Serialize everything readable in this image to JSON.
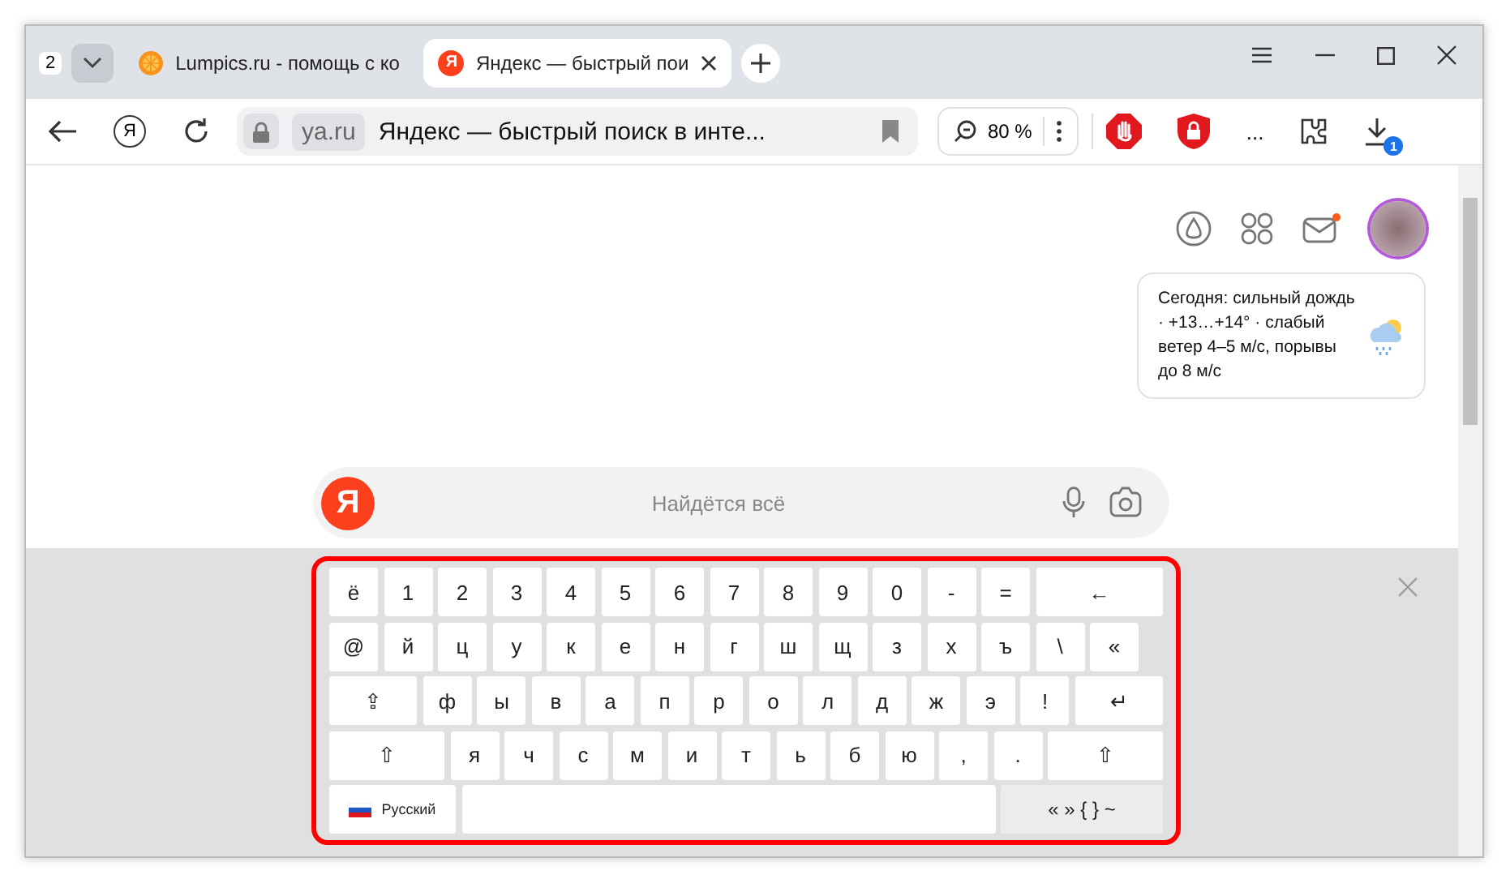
{
  "tab_bar": {
    "tab_count": "2",
    "tabs": [
      {
        "title": "Lumpics.ru - помощь с ко",
        "kind": "site",
        "selected": false
      },
      {
        "title": "Яндекс — быстрый пои",
        "kind": "yandex",
        "logo": "Я",
        "selected": true
      }
    ]
  },
  "toolbar": {
    "logo": "Я",
    "domain": "ya.ru",
    "page_title": "Яндекс — быстрый поиск в инте...",
    "zoom": "80 %",
    "more": "...",
    "downloads_badge": "1"
  },
  "page": {
    "weather": {
      "text": "Сегодня: сильный дождь · +13…+14° · слабый ветер 4–5 м/с, порывы до 8 м/с"
    },
    "search": {
      "logo": "Я",
      "placeholder": "Найдётся всё"
    }
  },
  "keyboard": {
    "rows": [
      {
        "keys": [
          {
            "label": "ё",
            "kind": "key"
          },
          {
            "label": "1",
            "kind": "key"
          },
          {
            "label": "2",
            "kind": "key"
          },
          {
            "label": "3",
            "kind": "key"
          },
          {
            "label": "4",
            "kind": "key"
          },
          {
            "label": "5",
            "kind": "key"
          },
          {
            "label": "6",
            "kind": "key"
          },
          {
            "label": "7",
            "kind": "key"
          },
          {
            "label": "8",
            "kind": "key"
          },
          {
            "label": "9",
            "kind": "key"
          },
          {
            "label": "0",
            "kind": "key"
          },
          {
            "label": "-",
            "kind": "key"
          },
          {
            "label": "=",
            "kind": "key"
          },
          {
            "label": "←",
            "kind": "wide"
          }
        ]
      },
      {
        "keys": [
          {
            "label": "@",
            "kind": "key"
          },
          {
            "label": "й",
            "kind": "key"
          },
          {
            "label": "ц",
            "kind": "key"
          },
          {
            "label": "у",
            "kind": "key"
          },
          {
            "label": "к",
            "kind": "key"
          },
          {
            "label": "е",
            "kind": "key"
          },
          {
            "label": "н",
            "kind": "key"
          },
          {
            "label": "г",
            "kind": "key"
          },
          {
            "label": "ш",
            "kind": "key"
          },
          {
            "label": "щ",
            "kind": "key"
          },
          {
            "label": "з",
            "kind": "key"
          },
          {
            "label": "х",
            "kind": "key"
          },
          {
            "label": "ъ",
            "kind": "key"
          },
          {
            "label": "\\",
            "kind": "key"
          },
          {
            "label": "«",
            "kind": "key"
          }
        ]
      },
      {
        "keys": [
          {
            "label": "⇪",
            "kind": "wide"
          },
          {
            "label": "ф",
            "kind": "key"
          },
          {
            "label": "ы",
            "kind": "key"
          },
          {
            "label": "в",
            "kind": "key"
          },
          {
            "label": "а",
            "kind": "key"
          },
          {
            "label": "п",
            "kind": "key"
          },
          {
            "label": "р",
            "kind": "key"
          },
          {
            "label": "о",
            "kind": "key"
          },
          {
            "label": "л",
            "kind": "key"
          },
          {
            "label": "д",
            "kind": "key"
          },
          {
            "label": "ж",
            "kind": "key"
          },
          {
            "label": "э",
            "kind": "key"
          },
          {
            "label": "!",
            "kind": "key"
          },
          {
            "label": "↵",
            "kind": "wide"
          }
        ]
      },
      {
        "keys": [
          {
            "label": "⇧",
            "kind": "wide"
          },
          {
            "label": "я",
            "kind": "key"
          },
          {
            "label": "ч",
            "kind": "key"
          },
          {
            "label": "с",
            "kind": "key"
          },
          {
            "label": "м",
            "kind": "key"
          },
          {
            "label": "и",
            "kind": "key"
          },
          {
            "label": "т",
            "kind": "key"
          },
          {
            "label": "ь",
            "kind": "key"
          },
          {
            "label": "б",
            "kind": "key"
          },
          {
            "label": "ю",
            "kind": "key"
          },
          {
            "label": ",",
            "kind": "key"
          },
          {
            "label": ".",
            "kind": "key"
          },
          {
            "label": "⇧",
            "kind": "wide"
          }
        ]
      },
      {
        "keys": [
          {
            "label": "Русский",
            "kind": "lang"
          },
          {
            "kind": "space"
          },
          {
            "label": "« » { } ~",
            "kind": "symbols"
          }
        ]
      }
    ]
  }
}
